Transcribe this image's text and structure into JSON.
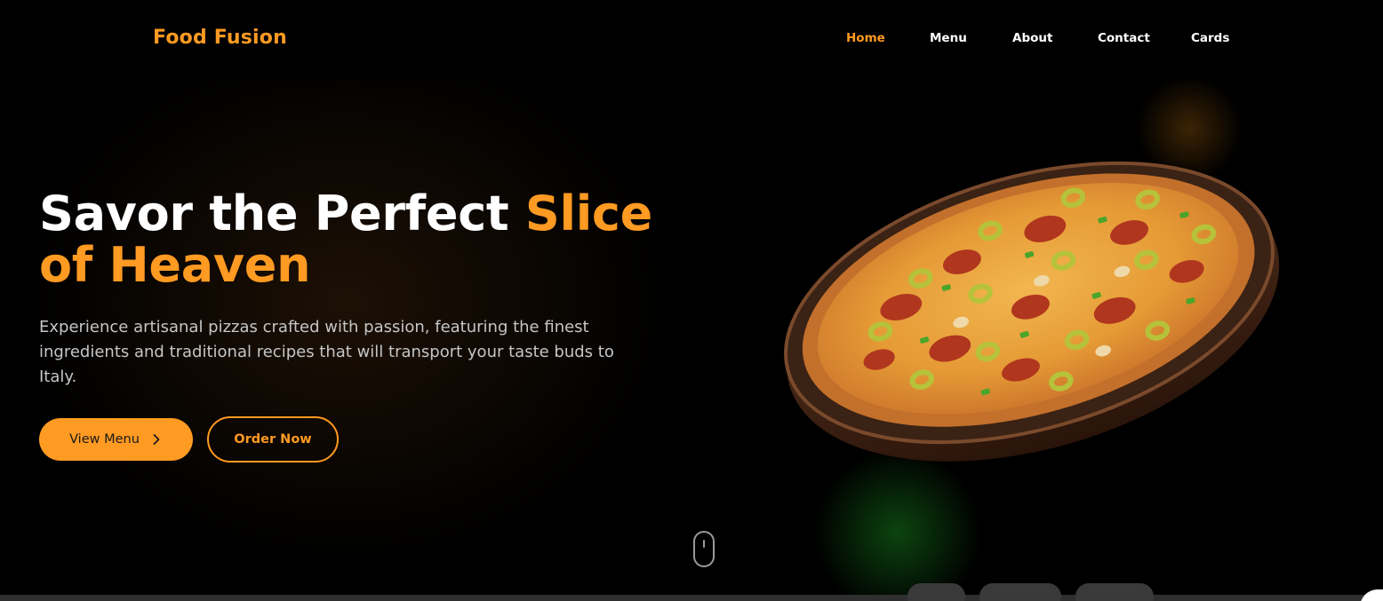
{
  "header": {
    "brand": "Food Fusion",
    "nav": [
      {
        "label": "Home",
        "active": true
      },
      {
        "label": "Menu",
        "active": false
      },
      {
        "label": "About",
        "active": false
      },
      {
        "label": "Contact",
        "active": false
      },
      {
        "label": "Cards",
        "active": false
      }
    ]
  },
  "hero": {
    "headline_part1": "Savor the Perfect ",
    "headline_accent": "Slice of Heaven",
    "subtitle": "Experience artisanal pizzas crafted with passion, featuring the finest ingredients and traditional recipes that will transport your taste buds to Italy.",
    "primary_button": "View Menu",
    "secondary_button": "Order Now"
  },
  "icons": {
    "chevron": "chevron-right-icon",
    "scroll": "mouse-scroll-icon",
    "hero_image": "pizza-image"
  },
  "colors": {
    "accent": "#ff9a22",
    "background": "#000000",
    "text": "#ffffff",
    "muted_text": "#c6c6c6"
  }
}
